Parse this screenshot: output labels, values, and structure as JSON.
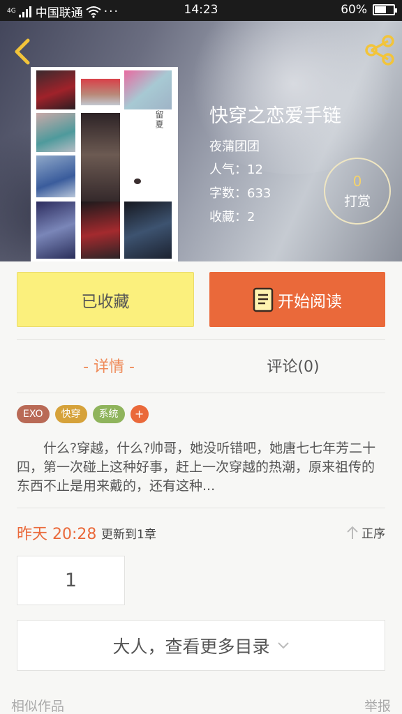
{
  "status_bar": {
    "carrier": "中国联通",
    "network": "4G",
    "time": "14:23",
    "battery": "60%",
    "battery_level": 0.6
  },
  "book": {
    "title": "快穿之恋爱手链",
    "author": "夜蒲团团",
    "popularity": "人气：12",
    "word_count": "字数：633",
    "favorites": "收藏：2",
    "tip_count": "0",
    "tip_label": "打赏"
  },
  "actions": {
    "collected_label": "已收藏",
    "read_label": "开始阅读"
  },
  "tabs": {
    "details": "- 详情 -",
    "comments": "评论(0)"
  },
  "tags": [
    {
      "label": "EXO",
      "color": "#b96a56"
    },
    {
      "label": "快穿",
      "color": "#d6a23a"
    },
    {
      "label": "系统",
      "color": "#8fb45c"
    }
  ],
  "tag_add": "+",
  "summary": "什么?穿越，什么?帅哥，她没听错吧，她唐七七年芳二十四，第一次碰上这种好事，赶上一次穿越的热潮，原来祖传的东西不止是用来戴的，还有这种...",
  "update": {
    "time": "昨天 20:28",
    "text": "更新到1章",
    "sort_label": "正序"
  },
  "chapter_number": "1",
  "more_catalog": "大人，查看更多目录",
  "footer": {
    "similar": "相似作品",
    "report": "举报"
  },
  "colors": {
    "accent": "#ea693a",
    "collected_bg": "#fbf07d",
    "tip_gold": "#f5d36a"
  }
}
